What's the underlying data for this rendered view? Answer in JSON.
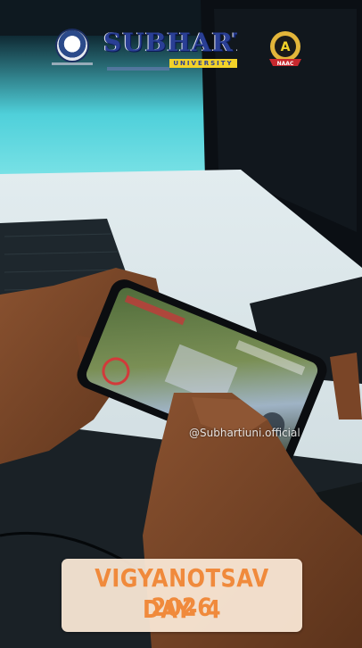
{
  "branding": {
    "university_name": "SUBHARTI",
    "university_word": "UNIVERSITY",
    "accreditation_grade": "A",
    "accreditation_body": "NAAC"
  },
  "watermark": {
    "handle": "@Subhartiuni.official"
  },
  "caption": {
    "line1": "VIGYANOTSAV 2026",
    "line2": "DAY- 4"
  },
  "colors": {
    "caption_text": "#f08a3c",
    "caption_bg": "#fae8d6",
    "wordmark_blue": "#2a3f95",
    "wordmark_gold": "#f2d229",
    "naac_gold": "#e3b53a",
    "naac_red": "#c7282e"
  }
}
